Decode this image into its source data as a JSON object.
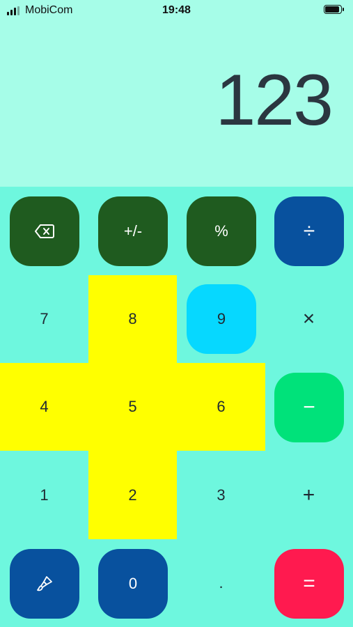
{
  "status_bar": {
    "carrier": "MobiCom",
    "time": "19:48"
  },
  "display": {
    "value": "123"
  },
  "keys": {
    "backspace": {
      "icon": "backspace-icon"
    },
    "plus_minus": {
      "label": "+/-"
    },
    "percent": {
      "label": "%"
    },
    "divide": {
      "label": "÷"
    },
    "seven": {
      "label": "7"
    },
    "eight": {
      "label": "8"
    },
    "nine": {
      "label": "9"
    },
    "multiply": {
      "label": "×"
    },
    "four": {
      "label": "4"
    },
    "five": {
      "label": "5"
    },
    "six": {
      "label": "6"
    },
    "minus": {
      "label": "−"
    },
    "one": {
      "label": "1"
    },
    "two": {
      "label": "2"
    },
    "three": {
      "label": "3"
    },
    "plus": {
      "label": "+"
    },
    "theme": {
      "icon": "paintbrush-icon"
    },
    "zero": {
      "label": "0"
    },
    "decimal": {
      "label": "."
    },
    "equals": {
      "label": "="
    }
  },
  "colors": {
    "background": "#6ef7de",
    "display_background": "#a6fde8",
    "highlight": "#ffff00",
    "dark_green": "#1f5b1f",
    "blue": "#08519e",
    "cyan": "#06d8ff",
    "green": "#00e27a",
    "red": "#ff1a4f"
  }
}
